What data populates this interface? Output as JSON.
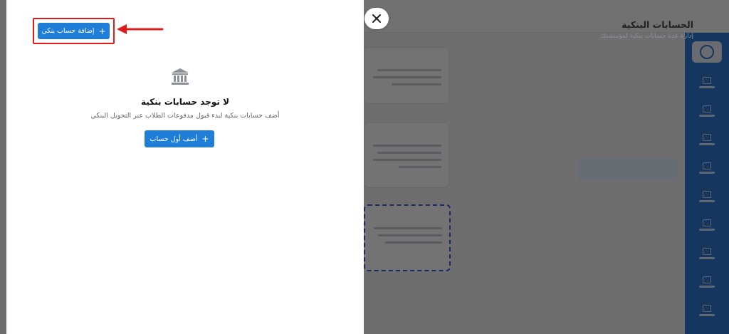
{
  "panel": {
    "title": "الحسابات البنكية",
    "subtitle": "إدارة عدة حسابات بنكية لمؤسستك",
    "add_button": {
      "label": "إضافة حساب بنكي",
      "icon": "plus-icon"
    },
    "close_icon": "close-icon"
  },
  "empty_state": {
    "icon": "bank-icon",
    "title": "لا توجد حسابات بنكية",
    "description": "أضف حسابات بنكية لبدء قبول مدفوعات الطلاب عبر التحويل البنكي",
    "add_first_button": {
      "label": "أضف أول حساب",
      "icon": "plus-icon"
    }
  },
  "annotation": {
    "highlight_color": "#e01b1b"
  },
  "colors": {
    "primary": "#1f7fd8",
    "sidebar": "#2f7bd3"
  }
}
